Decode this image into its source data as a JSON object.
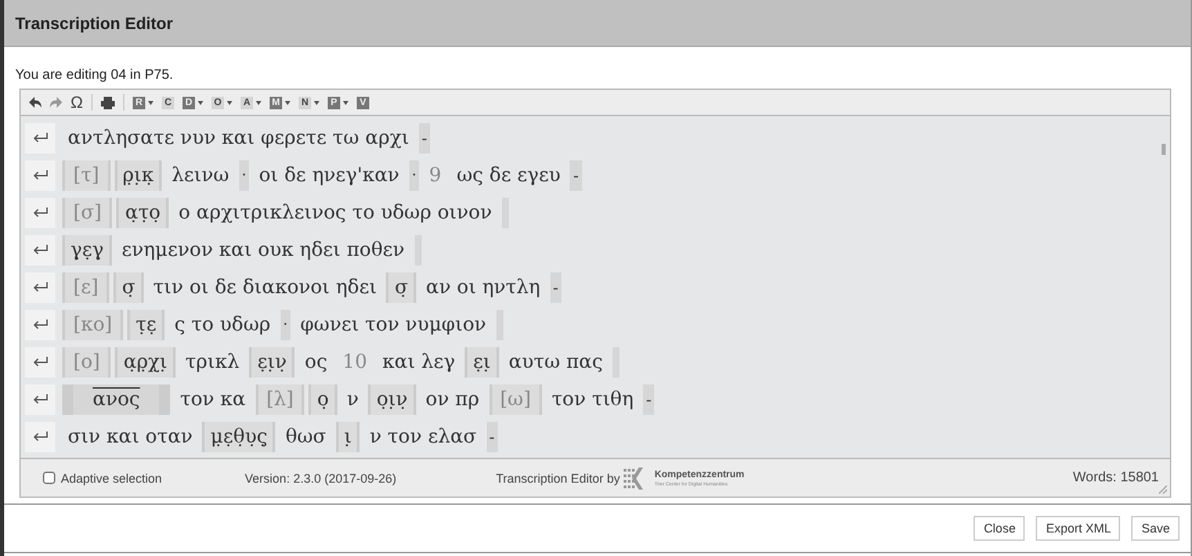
{
  "window": {
    "title": "Transcription Editor"
  },
  "info": "You are editing 04 in P75.",
  "toolbar": [
    {
      "kind": "undo-icon",
      "disabled": false
    },
    {
      "kind": "redo-icon",
      "disabled": true
    },
    {
      "kind": "omega",
      "label": "Ω",
      "disabled": false
    },
    {
      "kind": "print-icon",
      "disabled": false
    },
    {
      "kind": "letter",
      "label": "R",
      "disabled": false,
      "dropdown": true
    },
    {
      "kind": "letter",
      "label": "C",
      "disabled": true,
      "dropdown": false
    },
    {
      "kind": "letter",
      "label": "D",
      "disabled": false,
      "dropdown": true
    },
    {
      "kind": "letter",
      "label": "O",
      "disabled": true,
      "dropdown": true
    },
    {
      "kind": "letter",
      "label": "A",
      "disabled": true,
      "dropdown": true
    },
    {
      "kind": "letter",
      "label": "M",
      "disabled": false,
      "dropdown": true
    },
    {
      "kind": "letter",
      "label": "N",
      "disabled": true,
      "dropdown": true
    },
    {
      "kind": "letter",
      "label": "P",
      "disabled": false,
      "dropdown": true
    },
    {
      "kind": "letter",
      "label": "V",
      "disabled": false,
      "dropdown": false
    }
  ],
  "lines": [
    {
      "segments": [
        {
          "kind": "text",
          "text": "αντλησατε νυν και φερετε τω αρχι"
        },
        {
          "kind": "end",
          "text": "-"
        }
      ]
    },
    {
      "segments": [
        {
          "kind": "bracket",
          "text": "[τ]"
        },
        {
          "kind": "marked",
          "text": "ρ̣ι̣κ̣"
        },
        {
          "kind": "text",
          "text": "λεινω"
        },
        {
          "kind": "sep",
          "text": "·"
        },
        {
          "kind": "text",
          "text": "οι δε ηνεγ'καν"
        },
        {
          "kind": "sep",
          "text": "·"
        },
        {
          "kind": "number",
          "text": "9"
        },
        {
          "kind": "text",
          "text": "ως δε εγευ"
        },
        {
          "kind": "end",
          "text": "-"
        }
      ]
    },
    {
      "segments": [
        {
          "kind": "bracket",
          "text": "[σ]"
        },
        {
          "kind": "marked",
          "text": "α̣τ̣ο̣"
        },
        {
          "kind": "text",
          "text": "ο αρχιτρικλεινος το υδωρ οινον"
        },
        {
          "kind": "blank"
        }
      ]
    },
    {
      "segments": [
        {
          "kind": "marked",
          "text": "γ̣ε̣γ̣"
        },
        {
          "kind": "text",
          "text": "ενημενον και ουκ ηδει ποθεν"
        },
        {
          "kind": "blank"
        }
      ]
    },
    {
      "segments": [
        {
          "kind": "bracket",
          "text": "[ε]"
        },
        {
          "kind": "marked",
          "text": "σ̣"
        },
        {
          "kind": "text",
          "text": "τιν οι δε διακονοι ηδει"
        },
        {
          "kind": "marked",
          "text": "σ̣"
        },
        {
          "kind": "text",
          "text": "αν οι ηντλη"
        },
        {
          "kind": "end",
          "text": "-"
        }
      ]
    },
    {
      "segments": [
        {
          "kind": "bracket",
          "text": "[κο]"
        },
        {
          "kind": "marked",
          "text": "τ̣ε̣"
        },
        {
          "kind": "text",
          "text": "ς το υδωρ"
        },
        {
          "kind": "sep",
          "text": "·"
        },
        {
          "kind": "text",
          "text": "φωνει τον νυμφιον"
        },
        {
          "kind": "blank"
        }
      ]
    },
    {
      "segments": [
        {
          "kind": "bracket",
          "text": "[ο]"
        },
        {
          "kind": "marked",
          "text": "α̣ρ̣χ̣ι̣"
        },
        {
          "kind": "text",
          "text": "τρικλ"
        },
        {
          "kind": "marked",
          "text": "ε̣ι̣ν̣"
        },
        {
          "kind": "text",
          "text": "ος"
        },
        {
          "kind": "number",
          "text": "10"
        },
        {
          "kind": "text",
          "text": "και λεγ"
        },
        {
          "kind": "marked",
          "text": "ε̣ι̣"
        },
        {
          "kind": "text",
          "text": "αυτω πας"
        },
        {
          "kind": "blank"
        }
      ]
    },
    {
      "segments": [
        {
          "kind": "overline",
          "text": "ανος"
        },
        {
          "kind": "text",
          "text": "τον κα"
        },
        {
          "kind": "bracket",
          "text": "[λ]"
        },
        {
          "kind": "marked",
          "text": "ο̣"
        },
        {
          "kind": "text",
          "text": "ν"
        },
        {
          "kind": "marked",
          "text": "ο̣ι̣ν̣"
        },
        {
          "kind": "text",
          "text": "ον πρ"
        },
        {
          "kind": "bracket",
          "text": "[ω]"
        },
        {
          "kind": "text",
          "text": "τον τιθη"
        },
        {
          "kind": "end",
          "text": "-"
        }
      ]
    },
    {
      "segments": [
        {
          "kind": "text",
          "text": "σιν και οταν"
        },
        {
          "kind": "marked",
          "text": "μ̣ε̣θ̣υ̣ς̣"
        },
        {
          "kind": "text",
          "text": "θωσ"
        },
        {
          "kind": "marked",
          "text": "ι̣"
        },
        {
          "kind": "text",
          "text": "ν τον ελασ"
        },
        {
          "kind": "end",
          "text": "-"
        }
      ]
    }
  ],
  "footer": {
    "adaptive_selection": {
      "label": "Adaptive selection",
      "checked": false
    },
    "version": "Version: 2.3.0 (2017-09-26)",
    "credit": "Transcription Editor by",
    "logo": {
      "name": "Kompetenzzentrum",
      "subtitle": "Trier Center for Digital Humanities"
    },
    "words": "Words: 15801"
  },
  "buttons": [
    "Close",
    "Export XML",
    "Save"
  ]
}
